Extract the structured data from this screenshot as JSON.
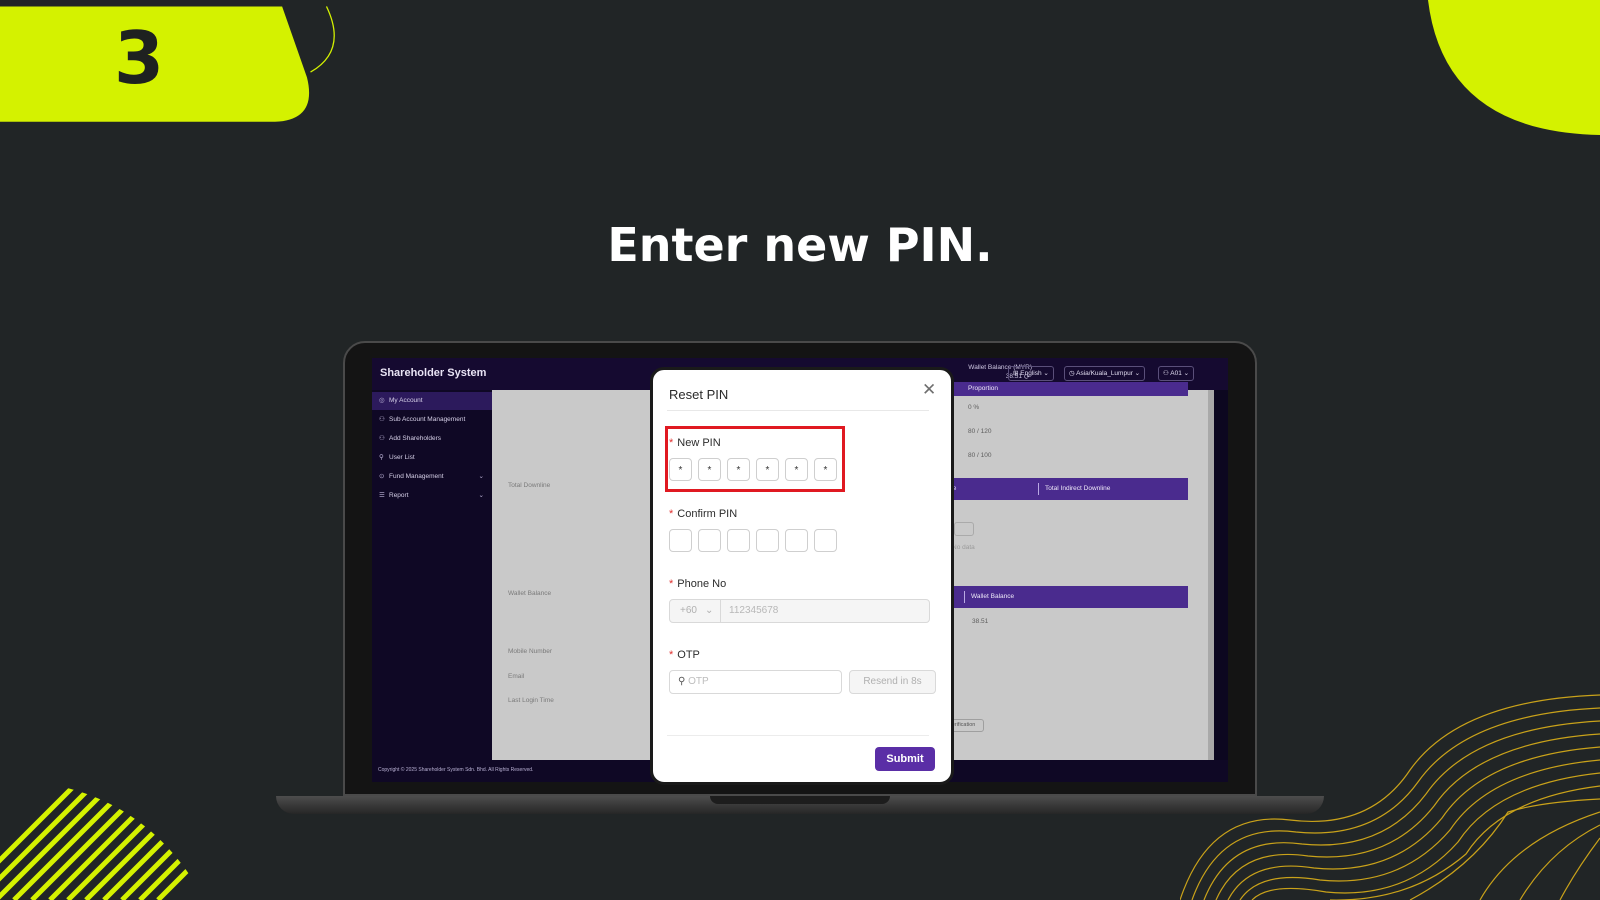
{
  "step": "3",
  "headline": "Enter new PIN.",
  "colors": {
    "accent": "#d4f200",
    "background": "#212526",
    "brand_purple": "#5a2ea6",
    "highlight_red": "#e01921"
  },
  "app": {
    "title": "Shareholder System",
    "wallet_label": "Wallet Balance (MYR)",
    "wallet_value": "38.51",
    "language": "English",
    "timezone": "Asia/Kuala_Lumpur",
    "user": "A01",
    "sidebar": [
      {
        "label": "My Account",
        "icon": "user-circle-icon"
      },
      {
        "label": "Sub Account Management",
        "icon": "users-icon"
      },
      {
        "label": "Add Shareholders",
        "icon": "user-add-icon"
      },
      {
        "label": "User List",
        "icon": "user-icon"
      },
      {
        "label": "Fund Management",
        "icon": "fund-icon"
      },
      {
        "label": "Report",
        "icon": "report-icon"
      }
    ],
    "labels": {
      "total_downline": "Total Downline",
      "wallet_balance": "Wallet Balance",
      "mobile_number": "Mobile Number",
      "email": "Email",
      "last_login_time": "Last Login Time"
    },
    "proportion_header": "Proportion",
    "proportion_values": [
      "0 %",
      "80 / 120",
      "80 / 100"
    ],
    "downline_header_a": "wnline",
    "downline_header_b": "Total Indirect Downline",
    "no_data": "No data",
    "wallet_header": "Wallet Balance",
    "wallet_row_value": "38.51",
    "verification_btn": "ty Verification",
    "copyright": "Copyright © 2025 Shareholder System Sdn. Bhd. All Rights Reserved."
  },
  "modal": {
    "title": "Reset PIN",
    "new_pin_label": "New PIN",
    "new_pin_digits": [
      "*",
      "*",
      "*",
      "*",
      "*",
      "*"
    ],
    "confirm_pin_label": "Confirm PIN",
    "phone_label": "Phone No",
    "phone_code": "+60",
    "phone_placeholder": "112345678",
    "otp_label": "OTP",
    "otp_placeholder": "OTP",
    "resend_label": "Resend in 8s",
    "submit_label": "Submit"
  }
}
